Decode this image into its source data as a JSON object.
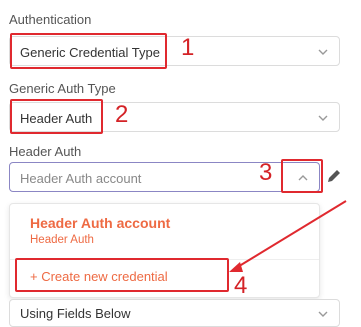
{
  "authentication": {
    "label": "Authentication",
    "value": "Generic Credential Type"
  },
  "generic_auth_type": {
    "label": "Generic Auth Type",
    "value": "Header Auth"
  },
  "header_auth": {
    "label": "Header Auth",
    "placeholder": "Header Auth account"
  },
  "dropdown": {
    "option_title": "Header Auth account",
    "option_subtitle": "Header Auth",
    "create_label": "+ Create new credential"
  },
  "next_field": {
    "value": "Using Fields Below"
  },
  "annotations": [
    "1",
    "2",
    "3",
    "4"
  ],
  "colors": {
    "accent": "#ee6a43",
    "annotation_red": "#e0292f",
    "focus_border": "#8b86c4"
  },
  "icons": [
    "chevron-down-icon",
    "chevron-up-icon",
    "pencil-icon",
    "arrow-annotation"
  ]
}
